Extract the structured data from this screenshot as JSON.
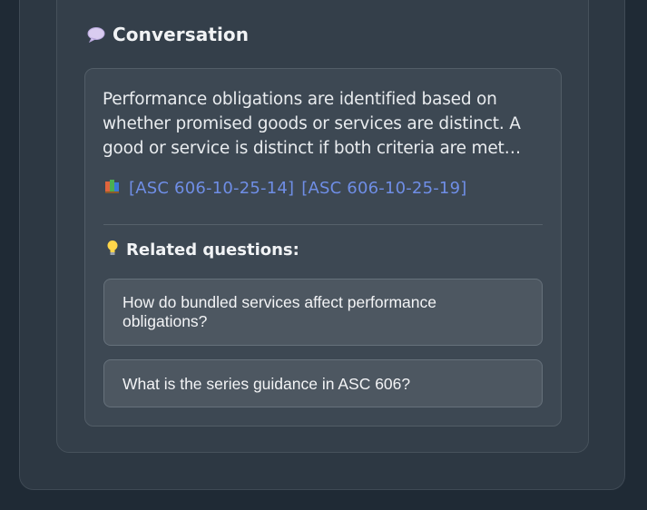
{
  "conversation": {
    "title": "Conversation",
    "icon": "speech-bubble-icon"
  },
  "message": {
    "text": "Performance obligations are identified based on whether promised goods or services are distinct. A good or service is distinct if both criteria are met…",
    "citations_icon": "books-icon",
    "citations": [
      "[ASC 606-10-25-14]",
      "[ASC 606-10-25-19]"
    ]
  },
  "related": {
    "title": "Related questions:",
    "icon": "lightbulb-icon",
    "questions": [
      "How do bundled services affect performance obligations?",
      "What is the series guidance in ASC 606?"
    ]
  },
  "colors": {
    "link": "#6f8ee6",
    "background": "#1f2a35"
  }
}
